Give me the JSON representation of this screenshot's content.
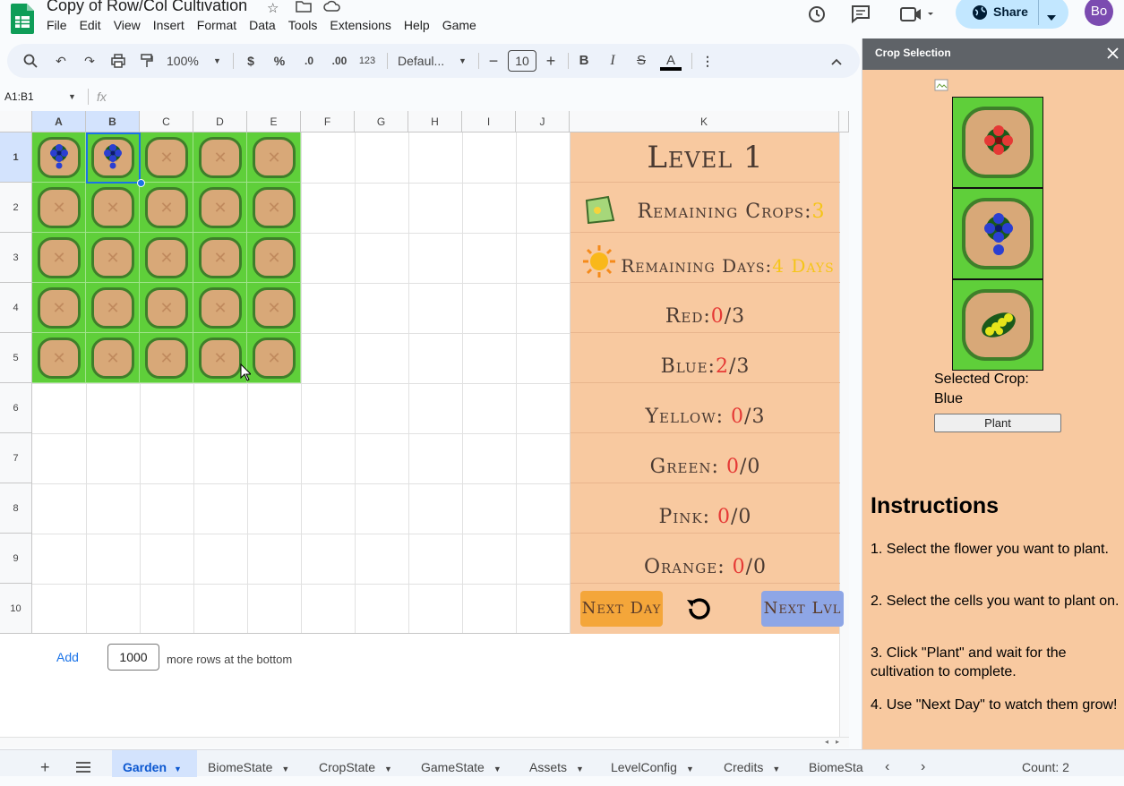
{
  "app": {
    "title": "Copy of Row/Col Cultivation",
    "menu": [
      "File",
      "Edit",
      "View",
      "Insert",
      "Format",
      "Data",
      "Tools",
      "Extensions",
      "Help",
      "Game"
    ],
    "share_label": "Share",
    "avatar_initials": "Bo"
  },
  "toolbar": {
    "zoom": "100%",
    "currency": "$",
    "percent": "%",
    "dec_decrease": ".0",
    "dec_increase": ".00",
    "number_format": "123",
    "font": "Defaul...",
    "font_size": "10",
    "bold": "B",
    "italic": "I",
    "text_color": "A"
  },
  "formula_bar": {
    "name_box": "A1:B1",
    "fx": "fx"
  },
  "grid": {
    "columns": [
      "A",
      "B",
      "C",
      "D",
      "E",
      "F",
      "G",
      "H",
      "I",
      "J",
      "K"
    ],
    "rows": [
      "1",
      "2",
      "3",
      "4",
      "5",
      "6",
      "7",
      "8",
      "9",
      "10"
    ]
  },
  "game_panel": {
    "level": "Level 1",
    "remaining_crops_label": "Remaining Crops:",
    "remaining_crops_value": "3",
    "remaining_days_label": "Remaining Days:",
    "remaining_days_value": "4 Days",
    "counts": [
      {
        "label": "Red:",
        "value": "0",
        "target": "/3"
      },
      {
        "label": "Blue:",
        "value": "2",
        "target": "/3"
      },
      {
        "label": "Yellow: ",
        "value": "0",
        "target": "/3"
      },
      {
        "label": "Green: ",
        "value": "0",
        "target": "/0"
      },
      {
        "label": "Pink: ",
        "value": "0",
        "target": "/0"
      },
      {
        "label": "Orange: ",
        "value": "0",
        "target": "/0"
      }
    ],
    "next_day_label": "Next Day",
    "next_level_label": "Next Lvl"
  },
  "add_rows": {
    "link": "Add",
    "count": "1000",
    "suffix": "more rows at the bottom"
  },
  "sheet_tabs": [
    "Garden",
    "BiomeState",
    "CropState",
    "GameState",
    "Assets",
    "LevelConfig",
    "Credits",
    "BiomeSta"
  ],
  "status": {
    "count": "Count: 2"
  },
  "sidebar": {
    "title": "Crop Selection",
    "selected_label": "Selected Crop:",
    "selected_value": "Blue",
    "plant_label": "Plant",
    "instructions_title": "Instructions",
    "instructions": [
      "1. Select the flower you want to plant.",
      "2. Select the cells you want to plant on.",
      "3. Click \"Plant\" and wait for the cultivation to complete.",
      "4. Use \"Next Day\" to watch them grow!"
    ]
  },
  "colors": {
    "grass": "#5fcf3a",
    "dirt": "#d8a878",
    "panel": "#f8c9a0",
    "red_flower": "#e53935",
    "blue_flower": "#2b3fd1",
    "yellow_flower": "#e5e51a"
  }
}
